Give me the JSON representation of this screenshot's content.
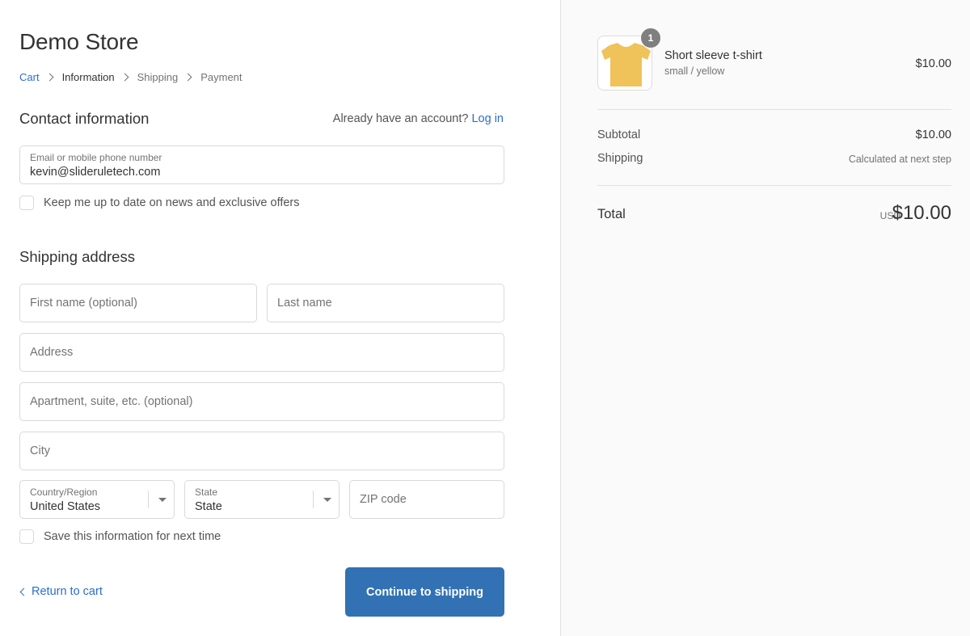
{
  "store": {
    "title": "Demo Store"
  },
  "breadcrumb": {
    "cart": "Cart",
    "information": "Information",
    "shipping": "Shipping",
    "payment": "Payment"
  },
  "contact": {
    "title": "Contact information",
    "account_prompt": "Already have an account?",
    "login_label": "Log in",
    "email_label": "Email or mobile phone number",
    "email_value": "kevin@slideruletech.com",
    "newsletter_label": "Keep me up to date on news and exclusive offers"
  },
  "shipping": {
    "title": "Shipping address",
    "first_name_placeholder": "First name (optional)",
    "last_name_placeholder": "Last name",
    "address_placeholder": "Address",
    "apartment_placeholder": "Apartment, suite, etc. (optional)",
    "city_placeholder": "City",
    "country_label": "Country/Region",
    "country_value": "United States",
    "state_label": "State",
    "state_value": "State",
    "zip_placeholder": "ZIP code",
    "save_info_label": "Save this information for next time"
  },
  "actions": {
    "return_label": "Return to cart",
    "continue_label": "Continue to shipping"
  },
  "order": {
    "item_quantity": "1",
    "item_name": "Short sleeve t-shirt",
    "item_variant": "small / yellow",
    "item_price": "$10.00",
    "subtotal_label": "Subtotal",
    "subtotal_value": "$10.00",
    "shipping_label": "Shipping",
    "shipping_value": "Calculated at next step",
    "total_label": "Total",
    "total_currency": "USD",
    "total_value": "$10.00"
  },
  "icons": {
    "product_image": "yellow-tshirt-icon",
    "breadcrumb_separator": "chevron-right-icon",
    "select_caret": "caret-down-icon",
    "return_chevron": "chevron-left-icon"
  },
  "colors": {
    "link": "#2c6ecb",
    "button": "#3272b4",
    "sidebar_bg": "#fafafa",
    "tshirt": "#efc35a",
    "badge": "#7f7f7f"
  }
}
